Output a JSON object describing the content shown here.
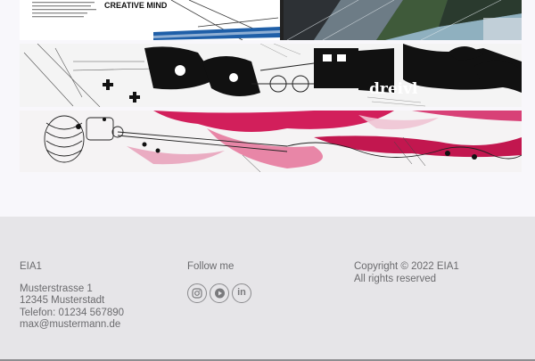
{
  "banners": [
    {
      "name": "magazine-spread",
      "caption": "CREATIVE MIND"
    },
    {
      "name": "locomotive-illustration",
      "caption": "dreivl"
    },
    {
      "name": "ink-splash-illustration"
    }
  ],
  "footer": {
    "brand": "EIA1",
    "address": {
      "street": "Musterstrasse 1",
      "city": "12345 Musterstadt",
      "phone": "Telefon: 01234 567890",
      "email": "max@mustermann.de"
    },
    "follow_label": "Follow me",
    "social": [
      {
        "name": "instagram-icon"
      },
      {
        "name": "youtube-icon"
      },
      {
        "name": "linkedin-icon",
        "glyph": "in"
      }
    ],
    "copyright": "Copyright © 2022 EIA1",
    "rights": "All rights reserved"
  },
  "colors": {
    "page_bg": "#f8f7fb",
    "footer_bg": "#e6e5e8",
    "footer_text": "#6b6b6e",
    "accent_magenta": "#d21f5b"
  }
}
